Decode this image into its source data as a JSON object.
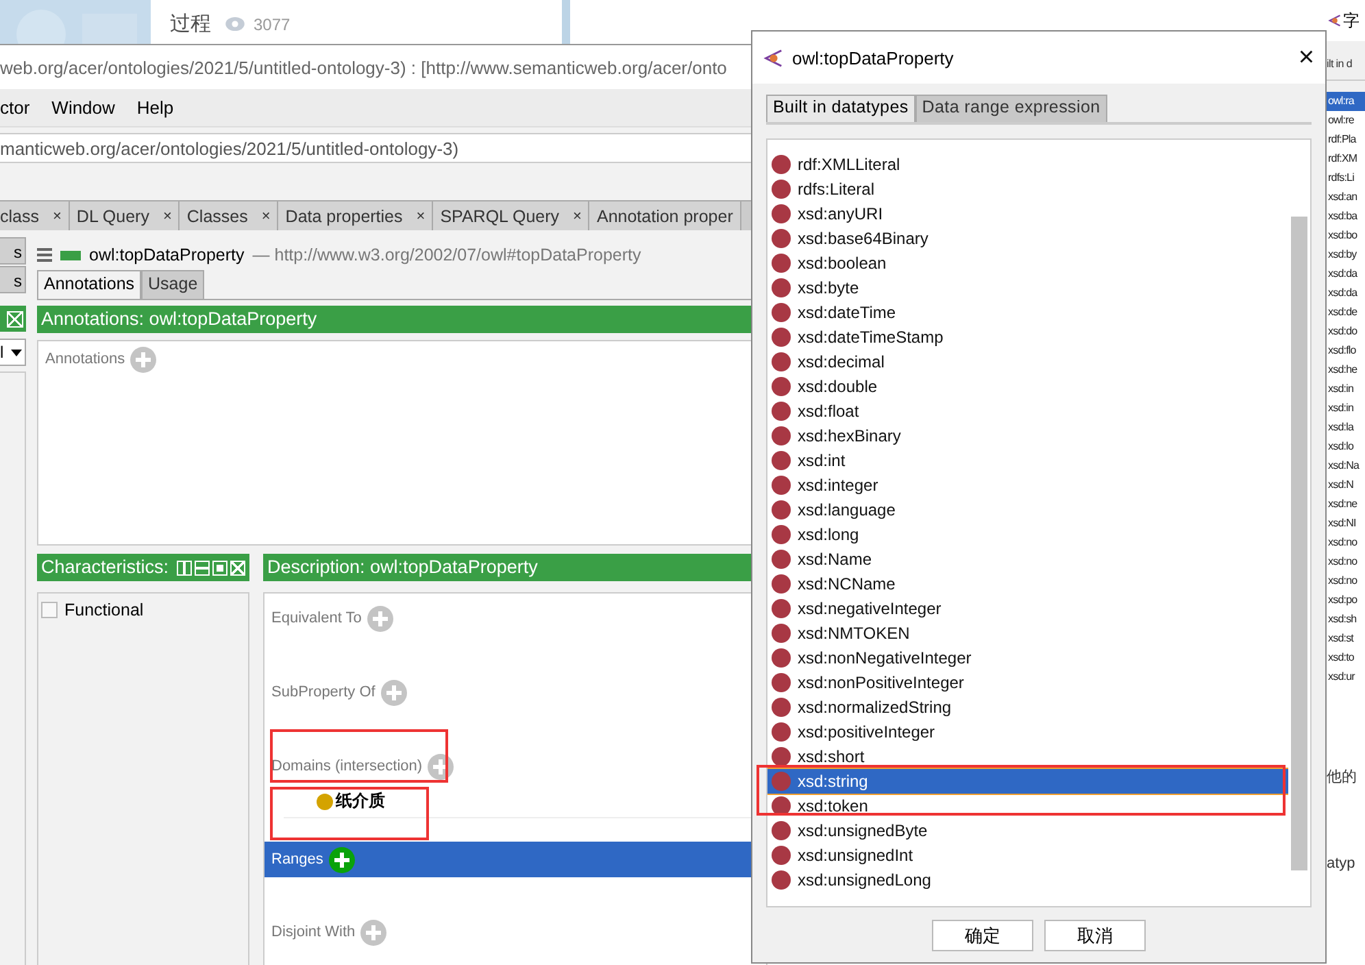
{
  "blog": {
    "title": "过程",
    "views": "3077"
  },
  "main_window": {
    "title": "web.org/acer/ontologies/2021/5/untitled-ontology-3)  : [http://www.semanticweb.org/acer/onto",
    "menu": [
      "ctor",
      "Window",
      "Help"
    ],
    "address": "manticweb.org/acer/ontologies/2021/5/untitled-ontology-3)",
    "tabs": [
      {
        "label": "class",
        "close": "×"
      },
      {
        "label": "DL Query",
        "close": "×"
      },
      {
        "label": "Classes",
        "close": "×"
      },
      {
        "label": "Data properties",
        "close": "×"
      },
      {
        "label": "SPARQL Query",
        "close": "×"
      },
      {
        "label": "Annotation proper"
      }
    ],
    "side_tabs": [
      "s",
      "s"
    ],
    "side_dropdown": "l",
    "entity": {
      "name": "owl:topDataProperty",
      "iri": "— http://www.w3.org/2002/07/owl#topDataProperty"
    },
    "view_tabs": [
      {
        "label": "Annotations",
        "selected": true
      },
      {
        "label": "Usage",
        "selected": false
      }
    ],
    "annotations": {
      "header": "Annotations: owl:topDataProperty",
      "label": "Annotations"
    },
    "characteristics": {
      "header": "Characteristics:",
      "items": [
        {
          "label": "Functional",
          "checked": false
        }
      ]
    },
    "description": {
      "header": "Description: owl:topDataProperty",
      "sections": [
        {
          "label": "Equivalent To",
          "selected": false
        },
        {
          "label": "SubProperty Of",
          "selected": false
        },
        {
          "label": "Domains (intersection)",
          "selected": false,
          "items": [
            "纸介质"
          ]
        },
        {
          "label": "Ranges",
          "selected": true
        },
        {
          "label": "Disjoint With",
          "selected": false
        }
      ]
    }
  },
  "dialog": {
    "title": "owl:topDataProperty",
    "close": "×",
    "tabs": [
      {
        "label": "Built in datatypes",
        "selected": true
      },
      {
        "label": "Data range expression",
        "selected": false
      }
    ],
    "items": [
      {
        "label": "rdf:XMLLiteral",
        "selected": false
      },
      {
        "label": "rdfs:Literal",
        "selected": false
      },
      {
        "label": "xsd:anyURI",
        "selected": false
      },
      {
        "label": "xsd:base64Binary",
        "selected": false
      },
      {
        "label": "xsd:boolean",
        "selected": false
      },
      {
        "label": "xsd:byte",
        "selected": false
      },
      {
        "label": "xsd:dateTime",
        "selected": false
      },
      {
        "label": "xsd:dateTimeStamp",
        "selected": false
      },
      {
        "label": "xsd:decimal",
        "selected": false
      },
      {
        "label": "xsd:double",
        "selected": false
      },
      {
        "label": "xsd:float",
        "selected": false
      },
      {
        "label": "xsd:hexBinary",
        "selected": false
      },
      {
        "label": "xsd:int",
        "selected": false
      },
      {
        "label": "xsd:integer",
        "selected": false
      },
      {
        "label": "xsd:language",
        "selected": false
      },
      {
        "label": "xsd:long",
        "selected": false
      },
      {
        "label": "xsd:Name",
        "selected": false
      },
      {
        "label": "xsd:NCName",
        "selected": false
      },
      {
        "label": "xsd:negativeInteger",
        "selected": false
      },
      {
        "label": "xsd:NMTOKEN",
        "selected": false
      },
      {
        "label": "xsd:nonNegativeInteger",
        "selected": false
      },
      {
        "label": "xsd:nonPositiveInteger",
        "selected": false
      },
      {
        "label": "xsd:normalizedString",
        "selected": false
      },
      {
        "label": "xsd:positiveInteger",
        "selected": false
      },
      {
        "label": "xsd:short",
        "selected": false
      },
      {
        "label": "xsd:string",
        "selected": true
      },
      {
        "label": "xsd:token",
        "selected": false
      },
      {
        "label": "xsd:unsignedByte",
        "selected": false
      },
      {
        "label": "xsd:unsignedInt",
        "selected": false
      },
      {
        "label": "xsd:unsignedLong",
        "selected": false
      }
    ],
    "buttons": [
      "确定",
      "取消"
    ]
  },
  "right_window": {
    "title": "字",
    "tab": "ilt in d",
    "items": [
      {
        "label": "owl:ra",
        "selected": true
      },
      {
        "label": "owl:re",
        "selected": false
      },
      {
        "label": "rdf:Pla",
        "selected": false
      },
      {
        "label": "rdf:XM",
        "selected": false
      },
      {
        "label": "rdfs:Li",
        "selected": false
      },
      {
        "label": "xsd:an",
        "selected": false
      },
      {
        "label": "xsd:ba",
        "selected": false
      },
      {
        "label": "xsd:bo",
        "selected": false
      },
      {
        "label": "xsd:by",
        "selected": false
      },
      {
        "label": "xsd:da",
        "selected": false
      },
      {
        "label": "xsd:da",
        "selected": false
      },
      {
        "label": "xsd:de",
        "selected": false
      },
      {
        "label": "xsd:do",
        "selected": false
      },
      {
        "label": "xsd:flo",
        "selected": false
      },
      {
        "label": "xsd:he",
        "selected": false
      },
      {
        "label": "xsd:in",
        "selected": false
      },
      {
        "label": "xsd:in",
        "selected": false
      },
      {
        "label": "xsd:la",
        "selected": false
      },
      {
        "label": "xsd:lo",
        "selected": false
      },
      {
        "label": "xsd:Na",
        "selected": false
      },
      {
        "label": "xsd:N",
        "selected": false
      },
      {
        "label": "xsd:ne",
        "selected": false
      },
      {
        "label": "xsd:NI",
        "selected": false
      },
      {
        "label": "xsd:no",
        "selected": false
      },
      {
        "label": "xsd:no",
        "selected": false
      },
      {
        "label": "xsd:no",
        "selected": false
      },
      {
        "label": "xsd:po",
        "selected": false
      },
      {
        "label": "xsd:sh",
        "selected": false
      },
      {
        "label": "xsd:st",
        "selected": false
      },
      {
        "label": "xsd:to",
        "selected": false
      },
      {
        "label": "xsd:ur",
        "selected": false
      }
    ],
    "texts": [
      "他的",
      "atyp"
    ]
  }
}
